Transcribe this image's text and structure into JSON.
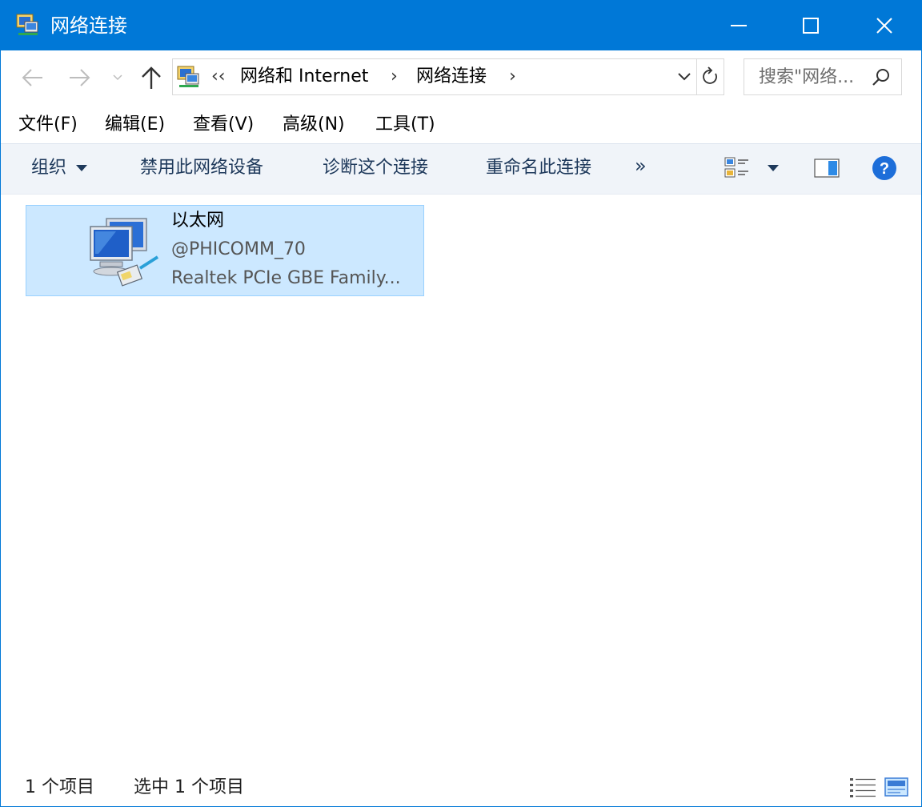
{
  "window": {
    "title": "网络连接",
    "accent": "#0078d7",
    "controls": {
      "minimize_icon": "minimize-icon",
      "maximize_icon": "maximize-icon",
      "close_icon": "close-icon"
    }
  },
  "nav": {
    "back_icon": "arrow-left-icon",
    "forward_icon": "arrow-right-icon",
    "recent_icon": "chevron-down-icon",
    "up_icon": "arrow-up-icon",
    "address": {
      "overflow": "‹‹",
      "crumbs": [
        {
          "label": "网络和 Internet"
        },
        {
          "label": "网络连接"
        }
      ],
      "separator": "›"
    },
    "search": {
      "placeholder": "搜索\"网络..."
    }
  },
  "menu": {
    "items": [
      {
        "label": "文件(F)"
      },
      {
        "label": "编辑(E)"
      },
      {
        "label": "查看(V)"
      },
      {
        "label": "高级(N)"
      },
      {
        "label": "工具(T)"
      }
    ]
  },
  "commands": {
    "organize": "组织",
    "disable": "禁用此网络设备",
    "diagnose": "诊断这个连接",
    "rename": "重命名此连接",
    "more": "»"
  },
  "connections": [
    {
      "name": "以太网",
      "status": "@PHICOMM_70",
      "device": "Realtek PCIe GBE Family...",
      "selected": true,
      "icon": "network-adapter-icon"
    }
  ],
  "status": {
    "count": "1 个项目",
    "selected": "选中 1 个项目"
  }
}
